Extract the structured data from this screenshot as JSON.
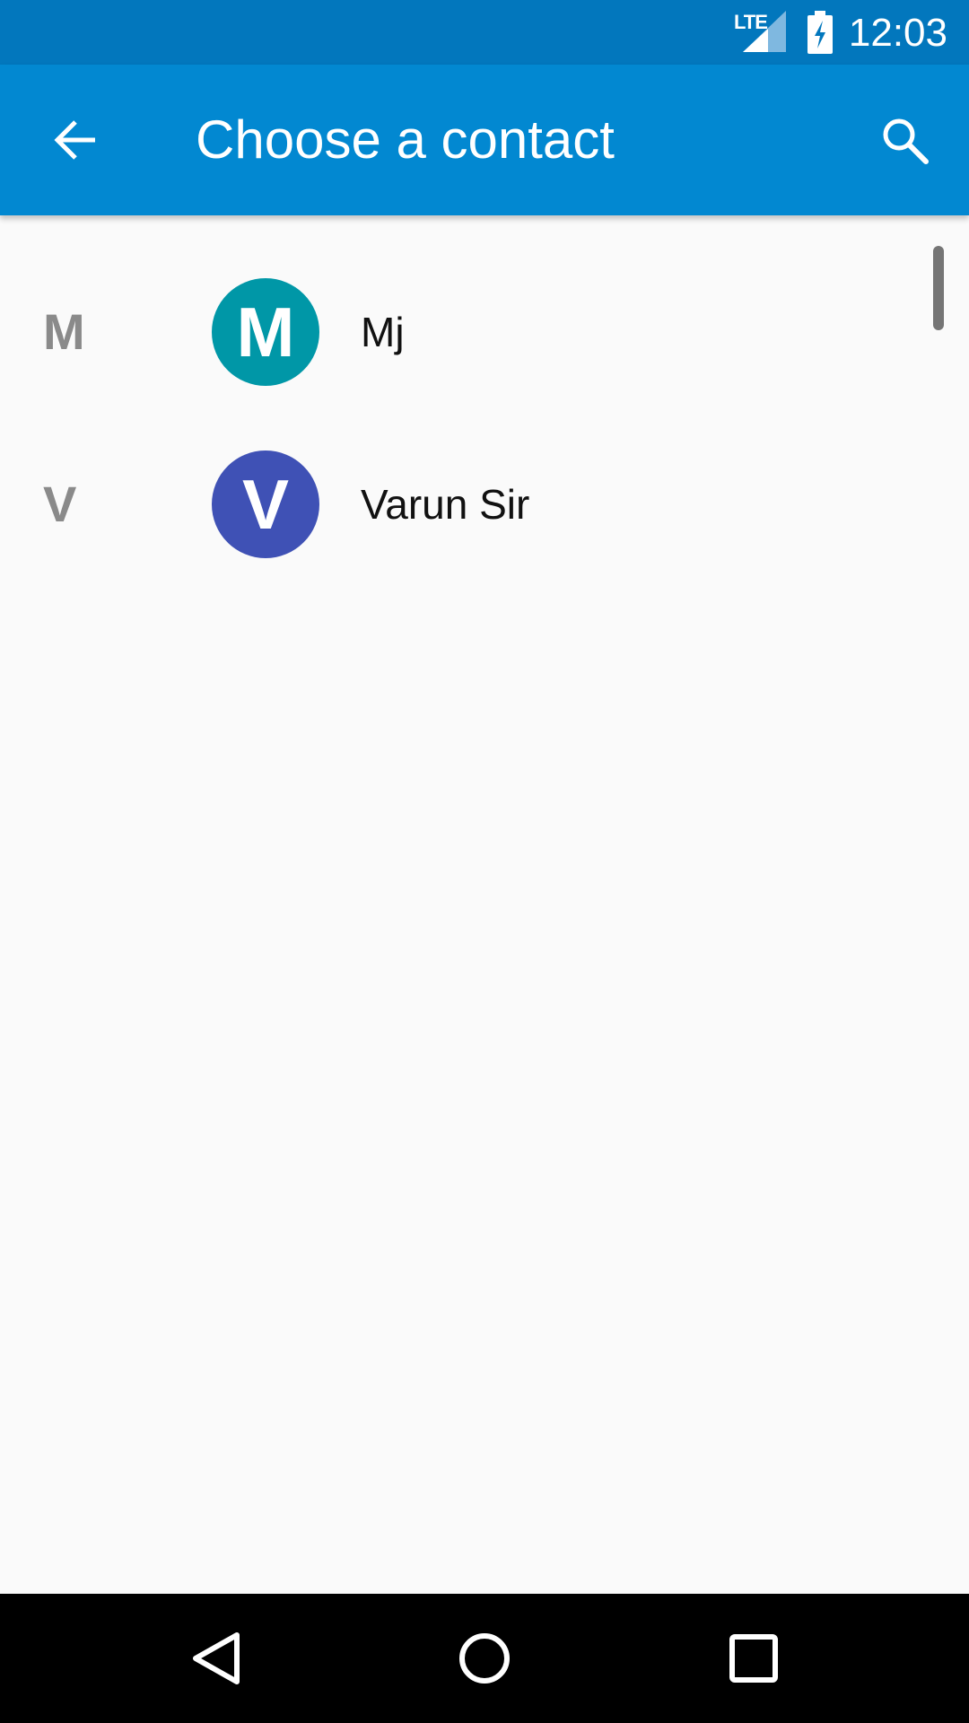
{
  "status_bar": {
    "network": "LTE",
    "time": "12:03",
    "signal_icon": "signal-icon",
    "battery_icon": "battery-charging-icon",
    "background_color": "#0277bd"
  },
  "app_bar": {
    "title": "Choose a contact",
    "back_icon": "arrow-back-icon",
    "search_icon": "search-icon",
    "background_color": "#0288d1"
  },
  "contacts": [
    {
      "section_letter": "M",
      "avatar_initial": "M",
      "avatar_color": "#0097a7",
      "name": "Mj"
    },
    {
      "section_letter": "V",
      "avatar_initial": "V",
      "avatar_color": "#3f51b5",
      "name": "Varun Sir"
    }
  ],
  "nav_bar": {
    "back_icon": "nav-back-icon",
    "home_icon": "nav-home-icon",
    "recents_icon": "nav-recents-icon"
  }
}
